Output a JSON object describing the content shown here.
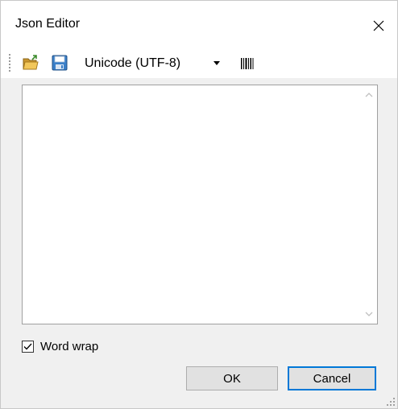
{
  "window": {
    "title": "Json Editor",
    "close_icon": "close-icon"
  },
  "toolbar": {
    "open_icon": "folder-open-icon",
    "save_icon": "floppy-disk-icon",
    "encoding_selected": "Unicode (UTF-8)",
    "dropdown_icon": "dropdown-arrow-icon",
    "barcode_icon": "barcode-icon"
  },
  "editor": {
    "content": "",
    "scroll_up_icon": "chevron-up-icon",
    "scroll_down_icon": "chevron-down-icon"
  },
  "options": {
    "word_wrap_label": "Word wrap",
    "word_wrap_checked": true
  },
  "buttons": {
    "ok_label": "OK",
    "cancel_label": "Cancel"
  },
  "colors": {
    "accent": "#0078d7",
    "folder": "#e8b84a",
    "floppy": "#3a7fc8"
  }
}
